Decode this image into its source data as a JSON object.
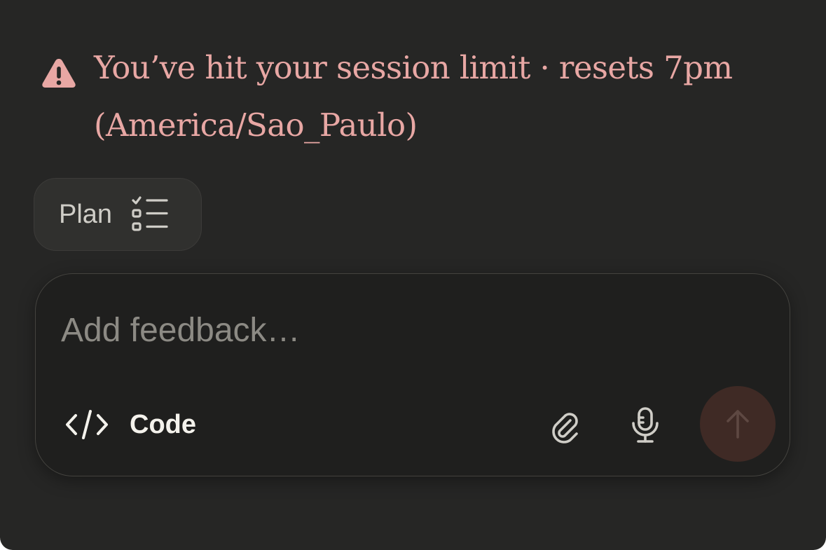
{
  "banner": {
    "line1": "You’ve hit your session limit · resets 7pm",
    "line2": "(America/Sao_Paulo)",
    "icon": "warning-triangle-icon",
    "color": "#e8a7a4"
  },
  "plan_chip": {
    "label": "Plan",
    "icon": "checklist-icon"
  },
  "composer": {
    "placeholder": "Add feedback…",
    "value": "",
    "code_label": "Code",
    "code_icon": "code-brackets-icon",
    "attach_icon": "paperclip-icon",
    "mic_icon": "microphone-icon",
    "send_icon": "arrow-up-icon",
    "send_color": "#3f2a25"
  }
}
